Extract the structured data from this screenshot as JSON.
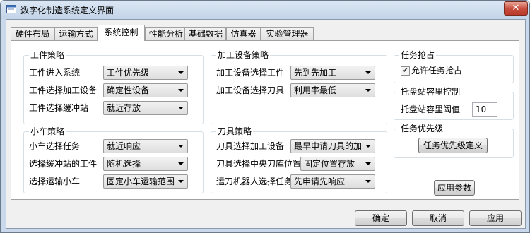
{
  "window": {
    "title": "数字化制造系统定义界面",
    "close_label": "✕"
  },
  "tabs": [
    "硬件布局",
    "运输方式",
    "系统控制",
    "性能分析",
    "基础数据",
    "仿真器",
    "实验管理器"
  ],
  "workpiece_policy": {
    "title": "工件策略",
    "rows": [
      {
        "label": "工件进入系统",
        "value": "工件优先级"
      },
      {
        "label": "工件选择加工设备",
        "value": "确定性设备"
      },
      {
        "label": "工件选择缓冲站",
        "value": "就近存放"
      }
    ]
  },
  "machine_policy": {
    "title": "加工设备策略",
    "rows": [
      {
        "label": "加工设备选择工件",
        "value": "先到先加工"
      },
      {
        "label": "加工设备选择刀具",
        "value": "利用率最低"
      }
    ]
  },
  "task_grab": {
    "title": "任务抢占",
    "checkbox_label": "允许任务抢占",
    "checked": true
  },
  "pallet": {
    "title": "托盘站容里控制",
    "label": "托盘站容里阈值",
    "value": "10"
  },
  "cart_policy": {
    "title": "小车策略",
    "rows": [
      {
        "label": "小车选择任务",
        "value": "就近响应"
      },
      {
        "label": "选择缓冲站的工件",
        "value": "随机选择"
      },
      {
        "label": "选择运输小车",
        "value": "固定小车运输范围"
      }
    ]
  },
  "tool_policy": {
    "title": "刀具策略",
    "rows": [
      {
        "label": "刀具选择加工设备",
        "value": "最早申请刀具的加"
      },
      {
        "label": "刀具选择中央刀库位置",
        "value": "固定位置存放"
      },
      {
        "label": "运刀机器人选择任务",
        "value": "先申请先响应"
      }
    ]
  },
  "task_priority": {
    "title": "任务优先级",
    "button": "任务优先级定义"
  },
  "apply_params": "应用参数",
  "footer": {
    "ok": "确定",
    "cancel": "取消",
    "apply": "应用"
  }
}
